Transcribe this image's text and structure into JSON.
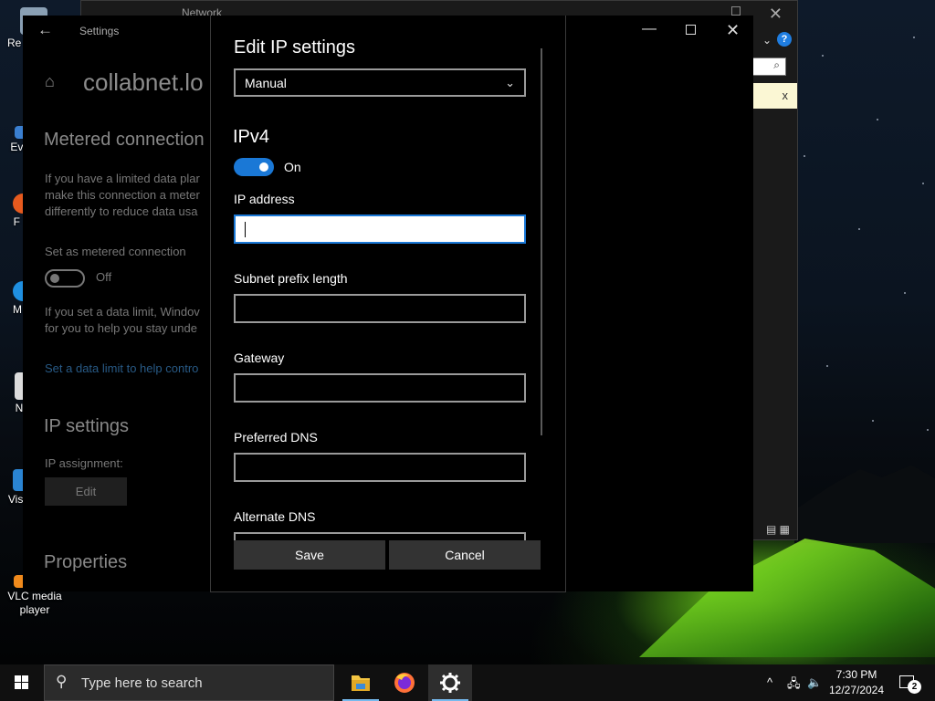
{
  "desktop": {
    "icons": [
      {
        "label": "Re",
        "color": "#8aa0b4"
      },
      {
        "label": "Eve",
        "color": "#3a7fd0"
      },
      {
        "label": "F",
        "color": "#e65a1e"
      },
      {
        "label": "M",
        "color": "#1f8fe0"
      },
      {
        "label": "No",
        "color": "#dcdcdc"
      },
      {
        "label": "Visu",
        "color": "#2a84d2"
      },
      {
        "label": "VLC media player",
        "color": "#f08a1c"
      }
    ]
  },
  "explorer": {
    "title": "Network",
    "close_glyph": "✕",
    "help_glyph": "?",
    "search_icon": "search-icon",
    "search_glyph": "⌕",
    "info_close_glyph": "x",
    "chevron_glyph": "⌄",
    "views_glyph": "▤ ▦"
  },
  "settings": {
    "window_title": "Settings",
    "back_glyph": "←",
    "home_glyph": "⌂",
    "network_name": "collabnet.lo",
    "metered": {
      "heading": "Metered connection",
      "text_lines": [
        "If you have a limited data plar",
        "make this connection a meter",
        "differently to reduce data usa"
      ],
      "toggle_label": "Set as metered connection",
      "toggle_state": "Off",
      "limit_lines": [
        "If you set a data limit, Windov",
        "for you to help you stay unde"
      ],
      "limit_link": "Set a data limit to help contro"
    },
    "ip_settings": {
      "heading": "IP settings",
      "assignment_label": "IP assignment:",
      "edit_button": "Edit"
    },
    "properties_heading": "Properties",
    "window_controls": {
      "minimize": "—",
      "close": "✕"
    }
  },
  "dialog": {
    "title": "Edit IP settings",
    "mode": {
      "selected": "Manual",
      "chevron": "⌄"
    },
    "ipv4": {
      "heading": "IPv4",
      "toggle_state": "On"
    },
    "fields": [
      {
        "label": "IP address",
        "value": ""
      },
      {
        "label": "Subnet prefix length",
        "value": ""
      },
      {
        "label": "Gateway",
        "value": ""
      },
      {
        "label": "Preferred DNS",
        "value": ""
      },
      {
        "label": "Alternate DNS",
        "value": ""
      }
    ],
    "save_button": "Save",
    "cancel_button": "Cancel"
  },
  "taskbar": {
    "search_placeholder": "Type here to search",
    "search_glyph": "⚲",
    "apps": [
      {
        "name": "file-explorer",
        "icon": "folder-icon",
        "color": "#f4c542"
      },
      {
        "name": "firefox",
        "icon": "firefox-icon",
        "color": "#ff7139"
      },
      {
        "name": "settings",
        "icon": "gear-icon",
        "color": "#ffffff",
        "active": true
      }
    ],
    "tray": {
      "chevron": "^",
      "network_glyph": "🖧",
      "volume_glyph": "🔈"
    },
    "clock": {
      "time": "7:30 PM",
      "date": "12/27/2024"
    },
    "notifications": {
      "count": "2"
    }
  },
  "colors": {
    "accent": "#1a78d6",
    "dialog_bg": "#000000",
    "taskbar_bg": "#101010"
  }
}
